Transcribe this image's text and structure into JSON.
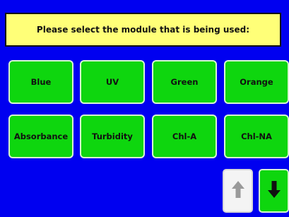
{
  "header": {
    "prompt": "Please select the module that is being used:"
  },
  "modules": [
    {
      "label": "Blue"
    },
    {
      "label": "UV"
    },
    {
      "label": "Green"
    },
    {
      "label": "Orange"
    },
    {
      "label": "Absorbance"
    },
    {
      "label": "Turbidity"
    },
    {
      "label": "Chl-A"
    },
    {
      "label": "Chl-NA"
    }
  ],
  "navigation": {
    "up_icon": "arrow-up-icon",
    "down_icon": "arrow-down-icon",
    "up_state": "disabled",
    "down_state": "enabled"
  },
  "colors": {
    "background": "#0000f0",
    "header_fill": "#ffff78",
    "button_fill": "#0ed60e",
    "disabled_fill": "#f4f4f4"
  }
}
